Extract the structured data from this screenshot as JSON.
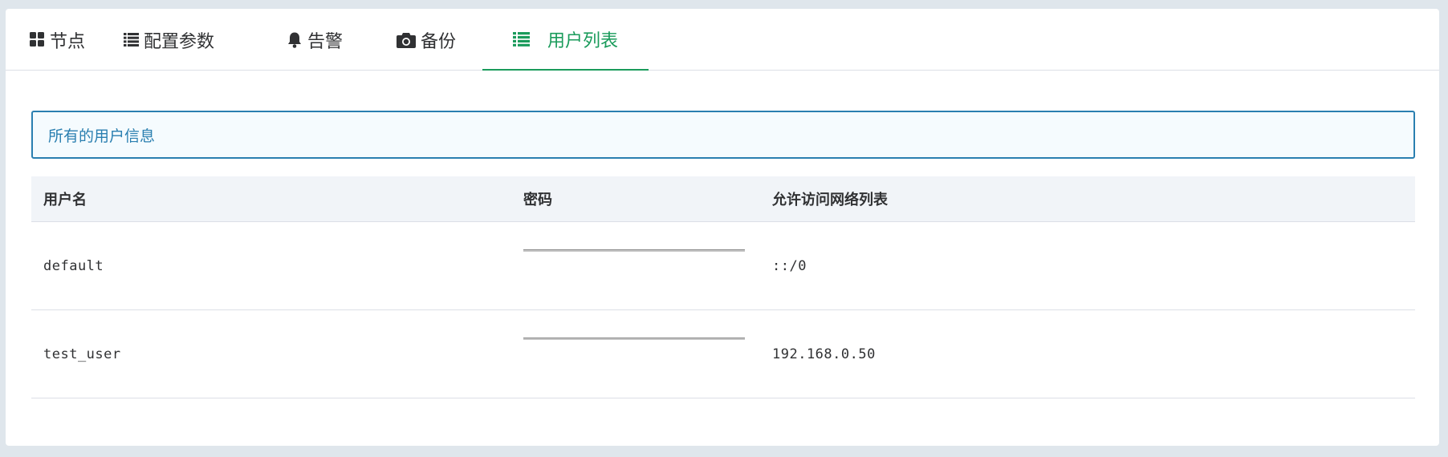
{
  "tabs": [
    {
      "label": "节点",
      "icon": "grid-icon",
      "active": false
    },
    {
      "label": "配置参数",
      "icon": "list-icon",
      "active": false
    },
    {
      "label": "告警",
      "icon": "bell-icon",
      "active": false
    },
    {
      "label": "备份",
      "icon": "camera-icon",
      "active": false
    },
    {
      "label": "用户列表",
      "icon": "list-icon",
      "active": true
    }
  ],
  "info": {
    "text": "所有的用户信息"
  },
  "table": {
    "headers": [
      "用户名",
      "密码",
      "允许访问网络列表"
    ],
    "rows": [
      {
        "username": "default",
        "network": "::/0"
      },
      {
        "username": "test_user",
        "network": "192.168.0.50"
      }
    ]
  },
  "colors": {
    "active_tab": "#1a9b5b",
    "info_border": "#2a7fb0",
    "info_text": "#2a7fb0"
  }
}
